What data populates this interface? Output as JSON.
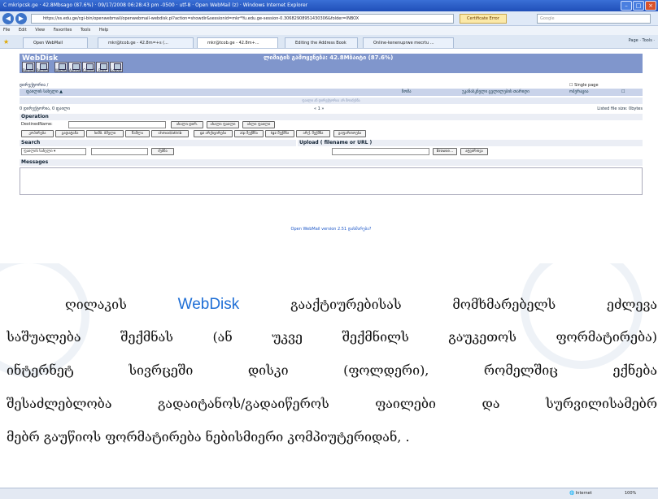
{
  "window": {
    "title": "C mkripcsk.ge · 42.8Mbsago (87.6%) · 09/17/2008 06:28:43 pm -0500 · utf-8 · Open WebMail (z) · Windows Internet Explorer",
    "address": "https://ss.edu.ge/cgi-bin/openwebmail/openwebmail-webdisk.pl?action=showdir&sessionid=mkr*Yu.edu.ge-session-0.30682908951430306&folder=INBOX",
    "certificate": "Certificate Error",
    "search_placeholder": "Google"
  },
  "menu": [
    "File",
    "Edit",
    "View",
    "Favorites",
    "Tools",
    "Help"
  ],
  "tabs": [
    {
      "label": "Open WebMail"
    },
    {
      "label": "mkr@tcob.ge - 42.8m=+s (..."
    },
    {
      "label": "mkr@tcob.ge - 42.8m+..."
    },
    {
      "label": "Editing the Address Book"
    },
    {
      "label": "Online-kenenuprwe mecrtu ..."
    }
  ],
  "tab_tools": "Page · Tools ·",
  "webdisk": {
    "title": "WebDisk",
    "quota": "ლიმიტის გამოყენება: 42.8Mბაიტი (87.6%)",
    "toolbar": [
      "Remote",
      "Refresh",
      "WebMail",
      "Addrbook",
      "Calendar",
      "Prefs",
      "Logout"
    ],
    "path_label": "დირექტორია /",
    "single_page": "Single page",
    "columns": [
      "ფაილის სახელი ▲",
      "ზომა",
      "უკანასკნელი ცვლილების თარიღი",
      "ოპერაცია"
    ],
    "empty_text": "ფაილი ან დირექტორია არ მოიძებნა",
    "summary": "0 დირექტორია, 0 ფაილი",
    "pager": "« 1 »",
    "listed_size": "Listed file size: 0bytes",
    "operation_label": "Operation",
    "destname_label": "DestinedName:",
    "op_row1": [
      "ახალი დირ.",
      "ახალი ფაილი",
      "ასლი ფაილი"
    ],
    "op_row2": [
      "კოპირება",
      "გადატანა",
      "სიმბ. ბმული",
      "წაშლა",
      "chmod/attrib",
      "gz არქივირება",
      "zip შექმნა",
      "tgz შექმნა",
      "არქ. შექმნა",
      "გაფართოება"
    ],
    "search_label": "Search",
    "search_select": "ფაილის სახელი",
    "search_button": "ძებნა",
    "upload_label": "Upload ( filename or URL )",
    "browse_button": "Browse...",
    "upload_button": "ატვირთვა",
    "messages_label": "Messages",
    "version": "Open WebMail version 2.51   დახმარება?"
  },
  "article": {
    "lines": [
      {
        "pre": "ღილაკის ",
        "hl": "WebDisk",
        "post": " გააქტიურებისას მომხმარებელს ეძლევა"
      },
      {
        "text": "საშუალება შექმნას (ან უკვე შექმნილს გაუკეთოს ფორმატირება)"
      },
      {
        "text": "ინტერნეტ სივრცეში დისკი (ფოლდერი), რომელშიც ექნება"
      },
      {
        "text": "შესაძლებლობა გადაიტანოს/გადაიწეროს ფაილები და სურვილისამებრ"
      },
      {
        "text": "მებრ გაუწიოს ფორმატირება ნებისმიერი კომპიუტერიდან, ."
      }
    ]
  },
  "status": {
    "zone": "Internet",
    "zoom": "100%"
  }
}
